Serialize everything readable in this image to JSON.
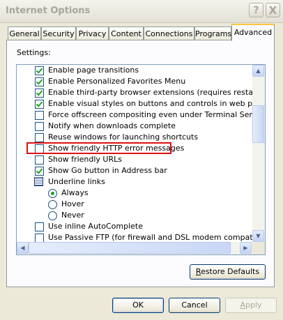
{
  "window": {
    "title": "Internet Options",
    "help_glyph": "?",
    "close_glyph": "X"
  },
  "tabs": [
    {
      "label": "General",
      "active": false
    },
    {
      "label": "Security",
      "active": false
    },
    {
      "label": "Privacy",
      "active": false
    },
    {
      "label": "Content",
      "active": false
    },
    {
      "label": "Connections",
      "active": false
    },
    {
      "label": "Programs",
      "active": false
    },
    {
      "label": "Advanced",
      "active": true
    }
  ],
  "settings_label": "Settings:",
  "settings": [
    {
      "type": "checkbox",
      "checked": true,
      "label": "Enable page transitions"
    },
    {
      "type": "checkbox",
      "checked": true,
      "label": "Enable Personalized Favorites Menu"
    },
    {
      "type": "checkbox",
      "checked": true,
      "label": "Enable third-party browser extensions (requires restart)"
    },
    {
      "type": "checkbox",
      "checked": true,
      "label": "Enable visual styles on buttons and controls in web pages"
    },
    {
      "type": "checkbox",
      "checked": false,
      "label": "Force offscreen compositing even under Terminal Server (requ"
    },
    {
      "type": "checkbox",
      "checked": false,
      "label": "Notify when downloads complete"
    },
    {
      "type": "checkbox",
      "checked": false,
      "label": "Reuse windows for launching shortcuts"
    },
    {
      "type": "checkbox",
      "checked": false,
      "label": "Show friendly HTTP error messages",
      "highlighted": true
    },
    {
      "type": "checkbox",
      "checked": false,
      "label": "Show friendly URLs"
    },
    {
      "type": "checkbox",
      "checked": true,
      "label": "Show Go button in Address bar"
    },
    {
      "type": "group",
      "label": "Underline links",
      "icon": "settings-group-icon"
    },
    {
      "type": "radio",
      "checked": true,
      "label": "Always"
    },
    {
      "type": "radio",
      "checked": false,
      "label": "Hover"
    },
    {
      "type": "radio",
      "checked": false,
      "label": "Never"
    },
    {
      "type": "checkbox",
      "checked": false,
      "label": "Use inline AutoComplete"
    },
    {
      "type": "checkbox",
      "checked": false,
      "label": "Use Passive FTP (for firewall and DSL modem compatibility)"
    }
  ],
  "buttons": {
    "restore_defaults": "Restore Defaults",
    "ok": "OK",
    "cancel": "Cancel",
    "apply": "Apply"
  },
  "colors": {
    "highlight_border": "#e01010",
    "check_green": "#21a121",
    "active_tab_accent": "#ffc73c"
  }
}
